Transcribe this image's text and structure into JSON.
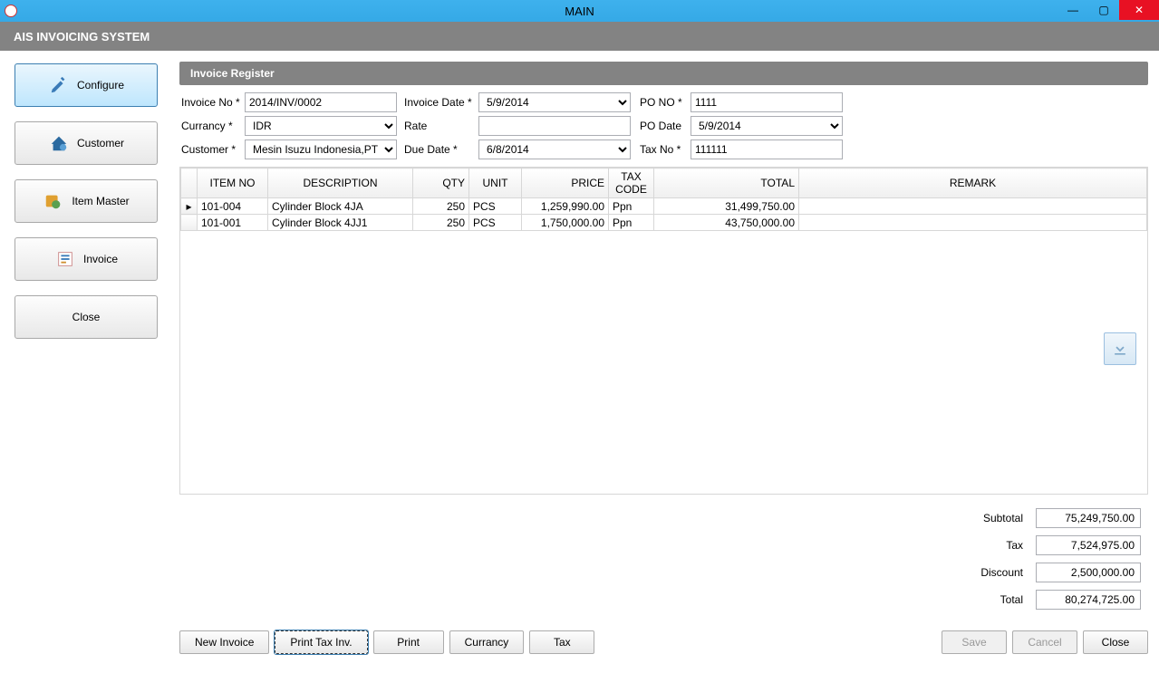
{
  "window": {
    "title": "MAIN",
    "app_title": "AIS INVOICING SYSTEM"
  },
  "sidebar": {
    "items": [
      {
        "label": "Configure",
        "icon": "configure"
      },
      {
        "label": "Customer",
        "icon": "customer"
      },
      {
        "label": "Item Master",
        "icon": "item-master"
      },
      {
        "label": "Invoice",
        "icon": "invoice"
      },
      {
        "label": "Close",
        "icon": ""
      }
    ]
  },
  "panel": {
    "title": "Invoice Register"
  },
  "form": {
    "labels": {
      "invoice_no": "Invoice No *",
      "invoice_date": "Invoice Date *",
      "po_no": "PO NO *",
      "currency": "Currancy *",
      "rate": "Rate",
      "po_date": "PO Date",
      "customer": "Customer *",
      "due_date": "Due Date *",
      "tax_no": "Tax No *"
    },
    "values": {
      "invoice_no": "2014/INV/0002",
      "invoice_date": "5/9/2014",
      "po_no": "1111",
      "currency": "IDR",
      "rate": "",
      "po_date": "5/9/2014",
      "customer": "Mesin Isuzu Indonesia,PT",
      "due_date": "6/8/2014",
      "tax_no": "111111"
    }
  },
  "grid": {
    "headers": [
      "ITEM NO",
      "DESCRIPTION",
      "QTY",
      "UNIT",
      "PRICE",
      "TAX CODE",
      "TOTAL",
      "REMARK"
    ],
    "rows": [
      {
        "item_no": "101-004",
        "desc": "Cylinder Block 4JA",
        "qty": "250",
        "unit": "PCS",
        "price": "1,259,990.00",
        "tax": "Ppn",
        "total": "31,499,750.00",
        "remark": ""
      },
      {
        "item_no": "101-001",
        "desc": "Cylinder Block 4JJ1",
        "qty": "250",
        "unit": "PCS",
        "price": "1,750,000.00",
        "tax": "Ppn",
        "total": "43,750,000.00",
        "remark": ""
      }
    ]
  },
  "totals": {
    "labels": {
      "subtotal": "Subtotal",
      "tax": "Tax",
      "discount": "Discount",
      "total": "Total"
    },
    "values": {
      "subtotal": "75,249,750.00",
      "tax": "7,524,975.00",
      "discount": "2,500,000.00",
      "total": "80,274,725.00"
    }
  },
  "actions": {
    "new_invoice": "New Invoice",
    "print_tax": "Print Tax Inv.",
    "print": "Print",
    "currency": "Currancy",
    "tax": "Tax",
    "save": "Save",
    "cancel": "Cancel",
    "close": "Close"
  }
}
